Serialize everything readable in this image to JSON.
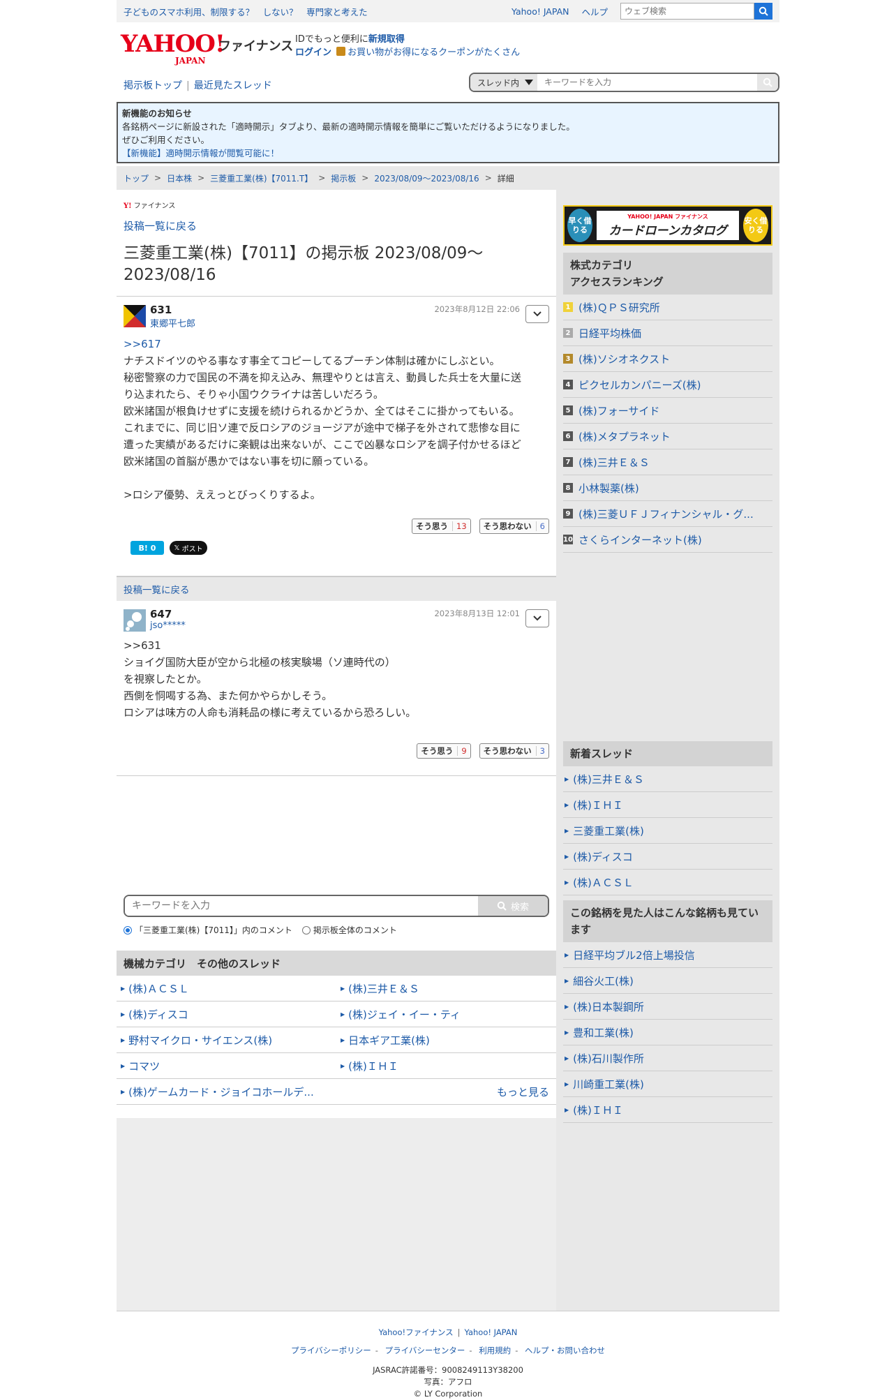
{
  "topbar": {
    "promo": "子どものスマホ利用、制限する？　しない？　専門家と考えた",
    "yahoo_japan": "Yahoo! JAPAN",
    "help": "ヘルプ",
    "web_search_placeholder": "ウェブ検索"
  },
  "header": {
    "logo_text": "YAHOO!",
    "logo_sub": "JAPAN",
    "service": "ファイナンス",
    "msg1_prefix": "IDでもっと便利に",
    "msg1_link": "新規取得",
    "login": "ログイン",
    "coupon": "お買い物がお得になるクーポンがたくさん"
  },
  "nav": {
    "board_top": "掲示板トップ",
    "recent": "最近見たスレッド",
    "scope": "スレッド内",
    "search_placeholder": "キーワードを入力"
  },
  "notice": {
    "head": "新機能のお知らせ",
    "line1": "各銘柄ページに新設された「適時開示」タブより、最新の適時開示情報を簡単にご覧いただけるようになりました。",
    "line2": "ぜひご利用ください。",
    "link": "【新機能】適時開示情報が閲覧可能に！"
  },
  "breadcrumb": [
    "トップ",
    "日本株",
    "三菱重工業(株)【7011.T】",
    "掲示板",
    "2023/08/09〜2023/08/16",
    "詳細"
  ],
  "main": {
    "small_logo": "ファイナンス",
    "back": "投稿一覧に戻る",
    "title": "三菱重工業(株)【7011】の掲示板 2023/08/09〜2023/08/16"
  },
  "posts": [
    {
      "num": "631",
      "user": "東郷平七郎",
      "time": "2023年8月12日 22:06",
      "reply": ">>617",
      "lines": [
        "ナチスドイツのやる事なす事全てコピーしてるプーチン体制は確かにしぶとい。",
        "秘密警察の力で国民の不満を抑え込み、無理やりとは言え、動員した兵士を大量に送",
        "り込まれたら、そりゃ小国ウクライナは苦しいだろう。",
        "欧米諸国が根負けせずに支援を続けられるかどうか、全てはそこに掛かってもいる。",
        "これまでに、同じ旧ソ連で反ロシアのジョージアが途中で梯子を外されて悲惨な目に",
        "遭った実績があるだけに楽観は出来ないが、ここで凶暴なロシアを調子付かせるほど",
        "欧米諸国の首脳が愚かではない事を切に願っている。",
        "",
        ">ロシア優勢、ええっとびっくりするよ。"
      ],
      "agree_label": "そう思う",
      "agree": "13",
      "disagree_label": "そう思わない",
      "disagree": "6",
      "hatena": "0",
      "x_label": "ポスト"
    },
    {
      "num": "647",
      "user": "jso*****",
      "time": "2023年8月13日 12:01",
      "lines": [
        ">>631",
        "ショイグ国防大臣が空から北極の核実験場（ソ連時代の）",
        "を視察したとか。",
        "西側を恫喝する為、また何かやらかしそう。",
        "ロシアは味方の人命も消耗品の様に考えているから恐ろしい。"
      ],
      "agree_label": "そう思う",
      "agree": "9",
      "disagree_label": "そう思わない",
      "disagree": "3"
    }
  ],
  "bottom_search": {
    "placeholder": "キーワードを入力",
    "button": "検索",
    "radio1": "「三菱重工業(株)【7011】」内のコメント",
    "radio2": "掲示板全体のコメント"
  },
  "other_threads": {
    "head": "機械カテゴリ　その他のスレッド",
    "items": [
      "(株)ＡＣＳＬ",
      "(株)三井Ｅ＆Ｓ",
      "(株)ディスコ",
      "(株)ジェイ・イー・ティ",
      "野村マイクロ・サイエンス(株)",
      "日本ギア工業(株)",
      "コマツ",
      "(株)ＩＨＩ",
      "(株)ゲームカード・ジョイコホールデ..."
    ],
    "more": "もっと見る"
  },
  "side": {
    "ad_left": "早く借りる",
    "ad_right": "安く借りる",
    "ad_brand": "YAHOO! JAPAN ファイナンス",
    "ad_title": "カードローンカタログ",
    "ranking_head1": "株式カテゴリ",
    "ranking_head2": "アクセスランキング",
    "ranking": [
      "(株)ＱＰＳ研究所",
      "日経平均株価",
      "(株)ソシオネクスト",
      "ピクセルカンパニーズ(株)",
      "(株)フォーサイド",
      "(株)メタプラネット",
      "(株)三井Ｅ＆Ｓ",
      "小林製薬(株)",
      "(株)三菱ＵＦＪフィナンシャル・グ...",
      "さくらインターネット(株)"
    ],
    "new_head": "新着スレッド",
    "new_threads": [
      "(株)三井Ｅ＆Ｓ",
      "(株)ＩＨＩ",
      "三菱重工業(株)",
      "(株)ディスコ",
      "(株)ＡＣＳＬ"
    ],
    "also_head": "この銘柄を見た人はこんな銘柄も見ています",
    "also": [
      "日経平均ブル2倍上場投信",
      "細谷火工(株)",
      "(株)日本製鋼所",
      "豊和工業(株)",
      "(株)石川製作所",
      "川崎重工業(株)",
      "(株)ＩＨＩ"
    ]
  },
  "footer": {
    "l1a": "Yahoo!ファイナンス",
    "l1b": "Yahoo! JAPAN",
    "links": [
      "プライバシーポリシー",
      "プライバシーセンター",
      "利用規約",
      "ヘルプ・お問い合わせ"
    ],
    "jasrac": "JASRAC許諾番号：9008249113Y38200",
    "photo": "写真：アフロ",
    "copyright": "© LY Corporation"
  },
  "colors": {
    "accent": "#1e5ba8",
    "brand": "#e60019",
    "search_blue": "#1e73d8"
  }
}
